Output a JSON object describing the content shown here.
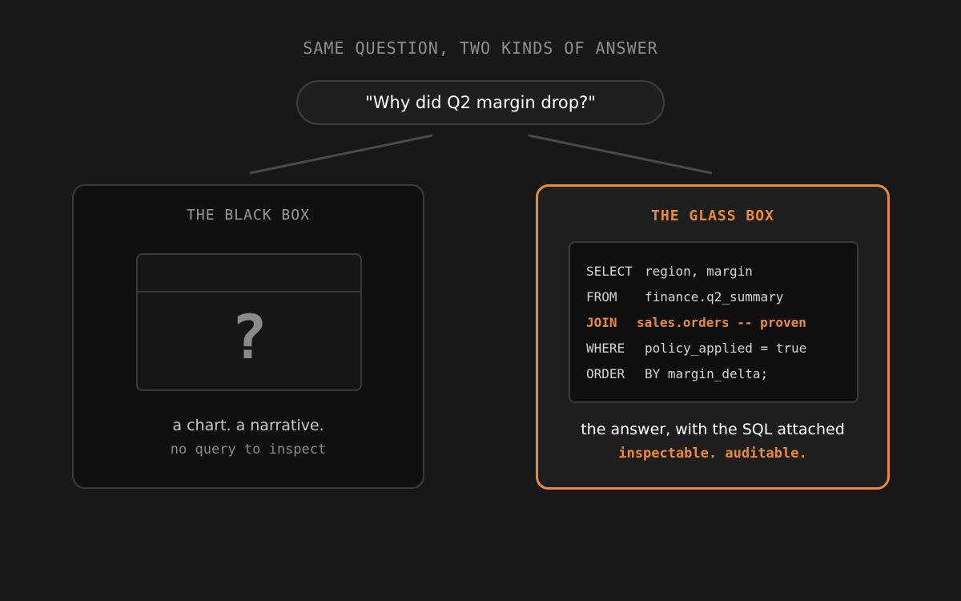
{
  "title": "SAME QUESTION, TWO KINDS OF ANSWER",
  "question": "\"Why did Q2 margin drop?\"",
  "colors": {
    "background": "#181818",
    "accent": "#ea8a3d",
    "muted": "#8f8f8f"
  },
  "black_box": {
    "title": "THE BLACK BOX",
    "icon": "question-mark-icon",
    "icon_glyph": "?",
    "caption": "a chart. a narrative.",
    "subcaption": "no query to inspect"
  },
  "glass_box": {
    "title": "THE GLASS BOX",
    "sql": [
      {
        "keyword": "SELECT",
        "rest": "region, margin",
        "highlight": false
      },
      {
        "keyword": "FROM",
        "rest": "finance.q2_summary",
        "highlight": false
      },
      {
        "keyword": "JOIN",
        "rest": "sales.orders -- proven",
        "highlight": true
      },
      {
        "keyword": "WHERE",
        "rest": "policy_applied = true",
        "highlight": false
      },
      {
        "keyword": "ORDER",
        "rest": "BY margin_delta;",
        "highlight": false
      }
    ],
    "caption": "the answer, with the SQL attached",
    "subcaption": "inspectable. auditable."
  }
}
